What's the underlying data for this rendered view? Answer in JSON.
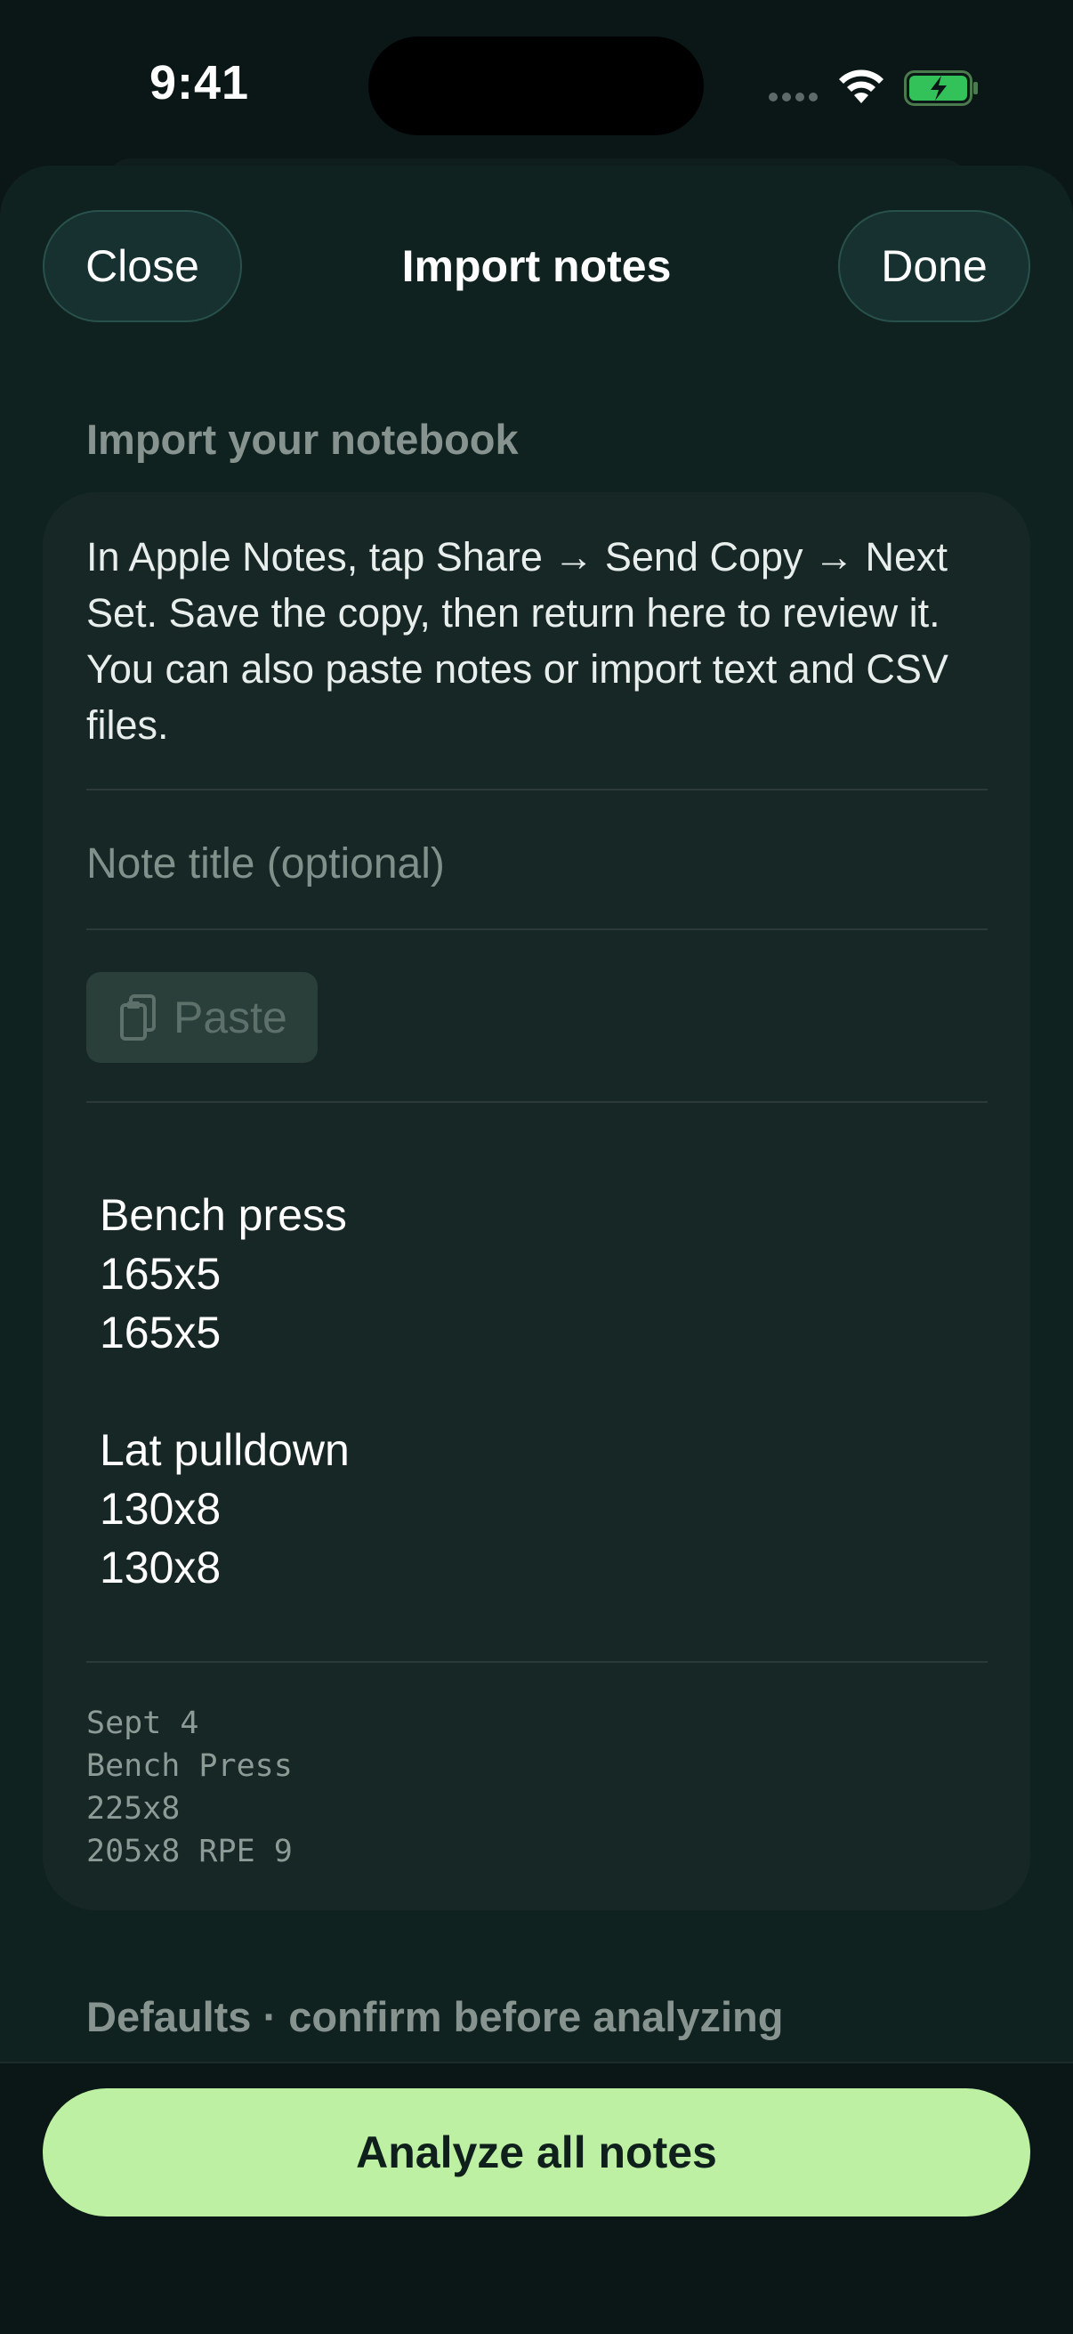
{
  "status_bar": {
    "time": "9:41"
  },
  "nav": {
    "close_label": "Close",
    "title": "Import notes",
    "done_label": "Done"
  },
  "import_section": {
    "header": "Import your notebook",
    "instructions": "In Apple Notes, tap Share → Send Copy → Next Set. Save the copy, then return here to review it. You can also paste notes or import text and CSV files.",
    "title_field": {
      "placeholder": "Note title (optional)",
      "value": ""
    },
    "paste_label": "Paste",
    "note_text": "Bench press\n165x5\n165x5\n\nLat pulldown\n130x8\n130x8",
    "sample_text": "Sept 4\nBench Press\n225x8\n205x8 RPE 9"
  },
  "defaults_section": {
    "header": "Defaults · confirm before analyzing"
  },
  "footer": {
    "analyze_label": "Analyze all notes"
  },
  "colors": {
    "accent": "#bdf0a2",
    "background": "#0b1716",
    "card": "#172725",
    "battery_charging": "#33c15a"
  },
  "icons": {
    "wifi": "wifi-icon",
    "battery": "battery-charging-icon",
    "paste": "clipboard-icon"
  }
}
